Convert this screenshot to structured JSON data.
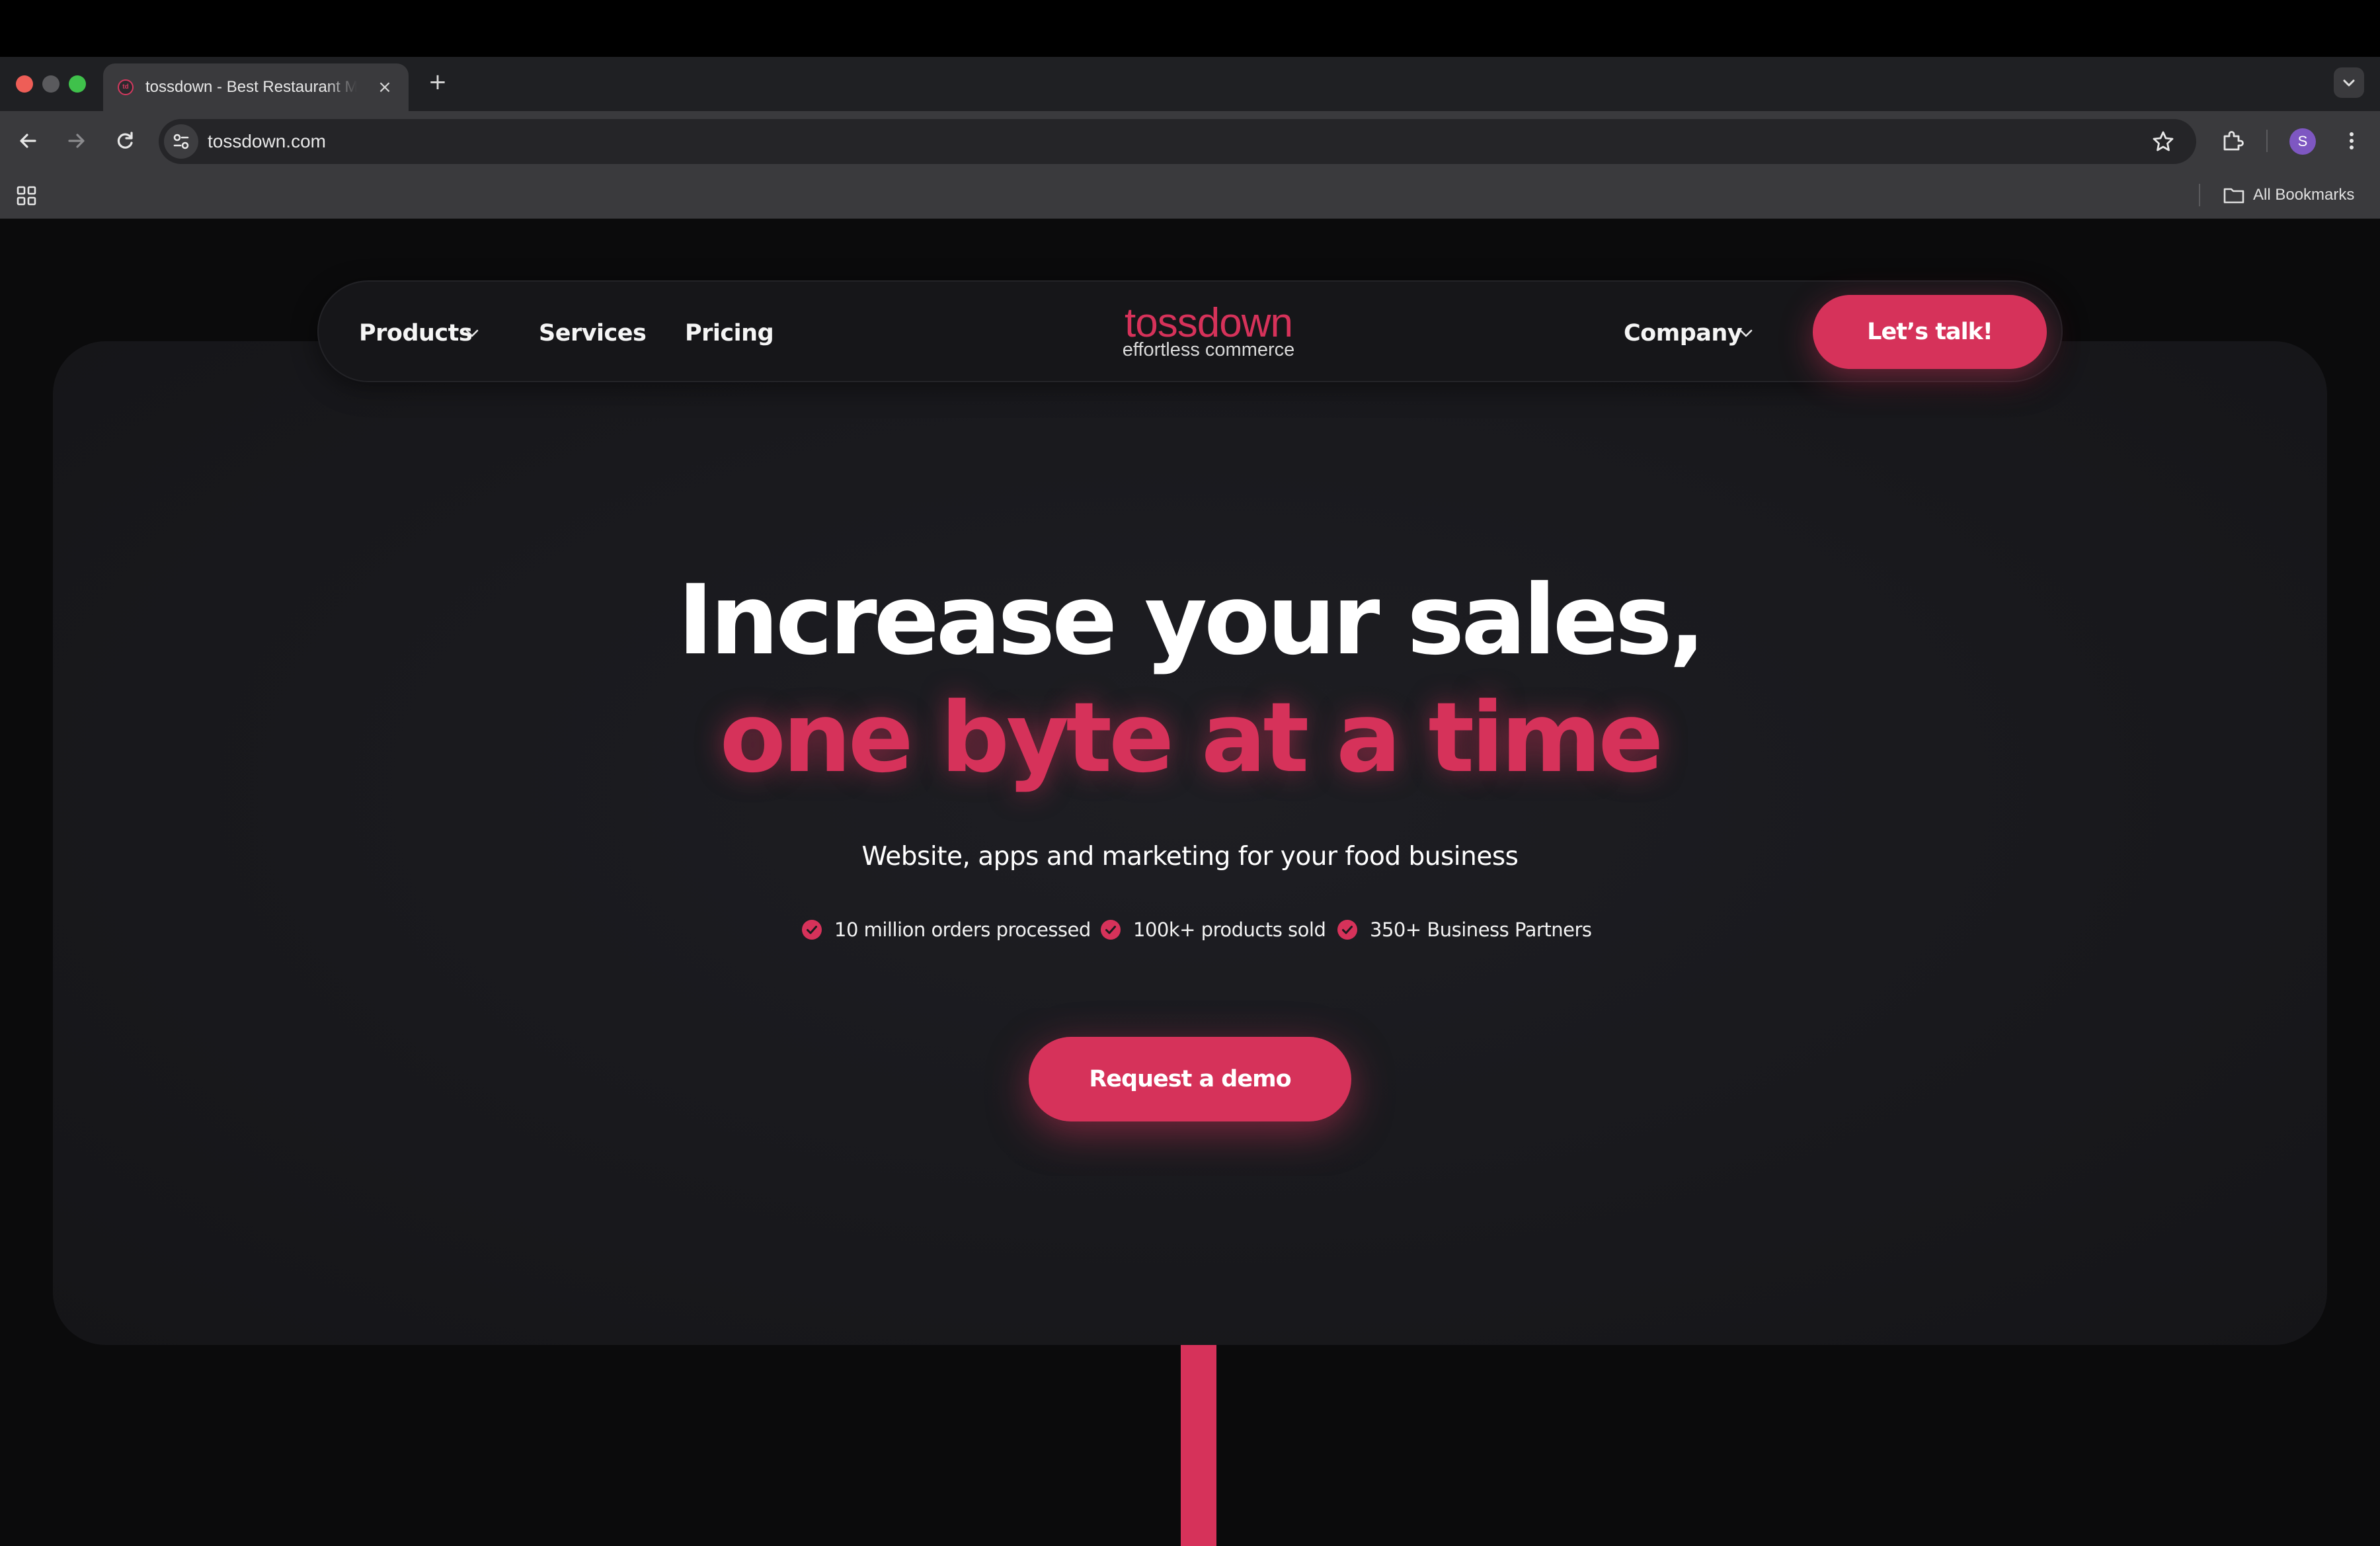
{
  "browser": {
    "tab": {
      "title": "tossdown - Best Restaurant Management Software"
    },
    "address_bar": {
      "url": "tossdown.com"
    },
    "bookmarks_bar": {
      "all_bookmarks_label": "All Bookmarks"
    },
    "profile_initial": "S"
  },
  "site": {
    "logo": {
      "wordmark": "tossdown",
      "tagline": "effortless commerce"
    },
    "nav": {
      "products": "Products",
      "services": "Services",
      "pricing": "Pricing",
      "company": "Company",
      "cta": "Let’s talk!"
    },
    "hero": {
      "headline_line1": "Increase your sales,",
      "headline_line2": "one byte at a time",
      "subheadline": "Website, apps and marketing for your food business",
      "stats": [
        "10 million orders processed",
        "100k+ products sold",
        "350+ Business Partners"
      ],
      "cta": "Request a demo"
    }
  },
  "colors": {
    "accent": "#d6325a",
    "page_background": "#0b0b0c",
    "card_background": "#1b1b1f",
    "browser_toolbar": "#3a3a3d"
  },
  "icons": [
    "back-arrow-icon",
    "forward-arrow-icon",
    "reload-icon",
    "site-info-icon",
    "star-icon",
    "extensions-icon",
    "kebab-menu-icon",
    "apps-grid-icon",
    "folder-icon",
    "chevron-down-icon",
    "check-circle-icon",
    "close-icon",
    "plus-icon"
  ]
}
